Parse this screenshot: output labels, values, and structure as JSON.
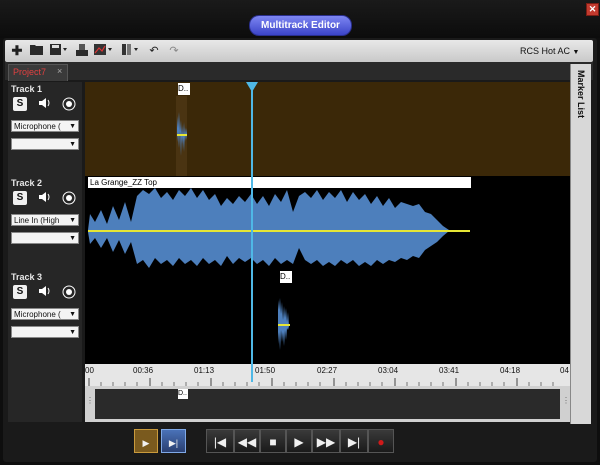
{
  "window": {
    "title": "Multitrack Editor",
    "close_glyph": "✕"
  },
  "toolbar": {
    "icons": [
      "add-icon",
      "open-folder-icon",
      "save-icon",
      "mixer-icon",
      "chart-icon",
      "layout-icon",
      "undo-icon",
      "redo-icon"
    ],
    "preset": "RCS Hot AC"
  },
  "tabs": {
    "project": "Project7",
    "close": "×"
  },
  "marker_list": {
    "label": "Marker List"
  },
  "tracks": [
    {
      "name": "Track  1",
      "input": "Microphone (",
      "output": "",
      "clip_label": "D.."
    },
    {
      "name": "Track  2",
      "input": "Line In (High",
      "output": "",
      "clip_label": "La Grange_ZZ Top"
    },
    {
      "name": "Track  3",
      "input": "Microphone (",
      "output": "",
      "clip_label": "D.."
    }
  ],
  "controls": {
    "solo": "S",
    "volume_icon": "speaker-icon",
    "record_icon": "record-icon"
  },
  "ruler": {
    "ticks": [
      "00",
      "00:36",
      "01:13",
      "01:50",
      "02:27",
      "03:04",
      "03:41",
      "04:18",
      "04"
    ]
  },
  "overview": {
    "clip_label": "D.."
  },
  "transport": {
    "buttons": [
      "play-clip",
      "play-selection",
      "go-to-start",
      "rewind",
      "stop",
      "play",
      "fast-forward",
      "go-to-end",
      "record"
    ]
  },
  "colors": {
    "track1_bg": "#3b2808",
    "waveform": "#4d7fbc",
    "center_line": "#e6e635",
    "playhead": "#4fb8e6",
    "title_pill": "#5a63e0",
    "record_red": "#d11a1a"
  }
}
